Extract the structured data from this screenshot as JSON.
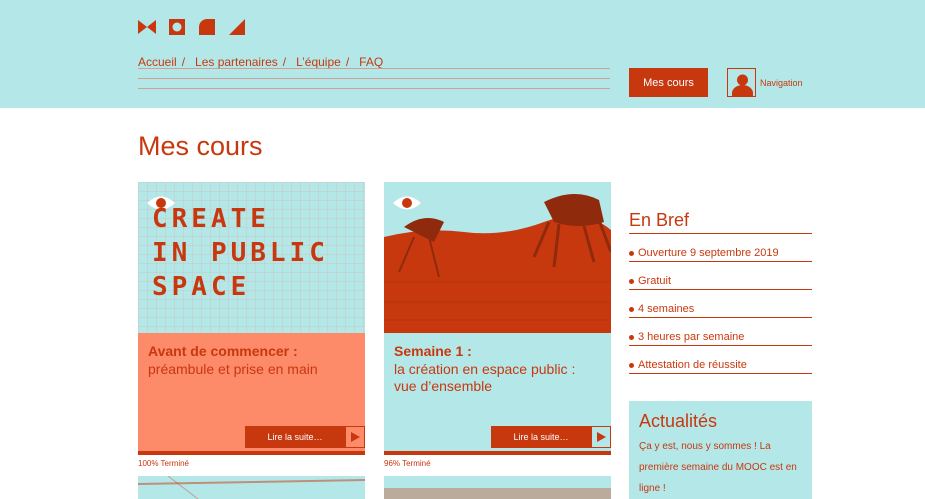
{
  "header": {
    "nav": [
      {
        "label": "Accueil"
      },
      {
        "label": "Les partenaires"
      },
      {
        "label": "L’équipe"
      },
      {
        "label": "FAQ"
      }
    ],
    "nav_separator": "/",
    "mes_cours_label": "Mes cours",
    "navigation_label": "Navigation"
  },
  "main": {
    "title": "Mes cours",
    "cards": [
      {
        "title": "Avant de commencer :",
        "subtitle": "préambule et prise en main",
        "read_more": "Lire la suite…",
        "progress": "100% Terminé",
        "image_lettering": [
          "CREATE",
          "IN PUBLIC",
          "SPACE"
        ]
      },
      {
        "title": "Semaine 1 :",
        "subtitle": "la création en espace public : vue d’ensemble",
        "read_more": "Lire la suite…",
        "progress": "96% Terminé"
      }
    ]
  },
  "sidebar": {
    "en_bref_title": "En Bref",
    "items": [
      "Ouverture 9 septembre 2019",
      "Gratuit",
      "4 semaines",
      "3 heures par semaine",
      "Attestation de réussite"
    ],
    "news_title": "Actualités",
    "news_text": "Ça y est, nous y sommes ! La première semaine du MOOC est en ligne !"
  },
  "colors": {
    "accent": "#c8380f",
    "header_bg": "#b4e8e8",
    "card1_body": "#fd8a68",
    "card2_body": "#b4e8e8"
  }
}
